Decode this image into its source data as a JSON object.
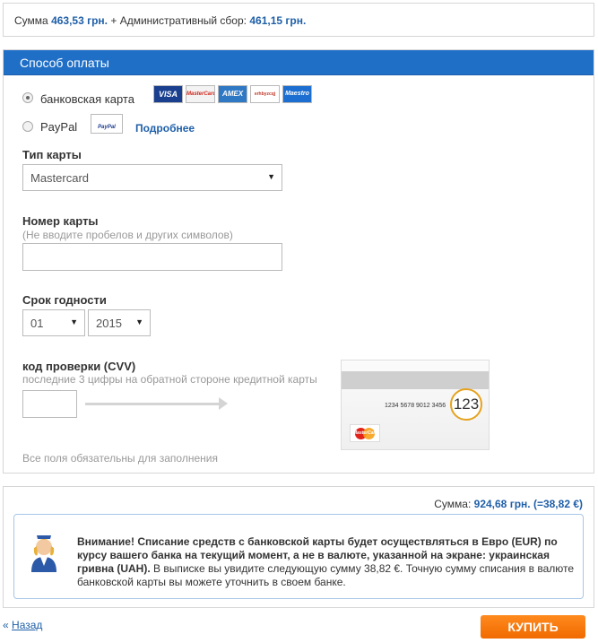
{
  "top": {
    "sum_label": "Сумма",
    "sum_value": "463,53 грн.",
    "plus": "+ Административный сбор:",
    "fee_value": "461,15 грн."
  },
  "payment": {
    "title": "Способ оплаты",
    "methods": [
      {
        "label": "банковская карта",
        "selected": true
      },
      {
        "label": "PayPal",
        "selected": false
      }
    ],
    "card_logos": [
      "VISA",
      "MasterCard",
      "AMEX",
      "erhbyzcqj",
      "Maestro"
    ],
    "paypal_logo": "PayPal",
    "more_link": "Подробнее",
    "card_type": {
      "label": "Тип карты",
      "value": "Mastercard"
    },
    "card_number": {
      "label": "Номер карты",
      "hint": "(Не вводите пробелов и других символов)",
      "value": ""
    },
    "expiry": {
      "label": "Срок годности",
      "month": "01",
      "year": "2015"
    },
    "cvv": {
      "label": "код проверки (CVV)",
      "hint": "последние 3 цифры на обратной стороне кредитной карты",
      "value": "",
      "card_number_sample": "1234 5678 9012 3456",
      "card_cvv_sample": "123",
      "card_brand": "MasterCard"
    },
    "required_note": "Все поля обязательны для заполнения"
  },
  "summary": {
    "sum_label": "Сумма:",
    "sum_value": "924,68 грн.",
    "sum_eur": "(=38,82 €)",
    "warning_bold": "Внимание! Списание средств с банковской карты будет осуществляться в Евро (EUR) по курсу вашего банка на текущий момент, а не в валюте, указанной на экране: украинская гривна (UAH).",
    "warning_text": "В выписке вы увидите следующую сумму 38,82 €. Точную сумму списания в валюте банковской карты вы можете уточнить в своем банке."
  },
  "footer": {
    "back_arrows": "«",
    "back_label": "Назад",
    "buy_label": "КУПИТЬ"
  },
  "colors": {
    "accent": "#1f6fc7",
    "link": "#1f5fa8",
    "buy": "#f57a0a"
  }
}
